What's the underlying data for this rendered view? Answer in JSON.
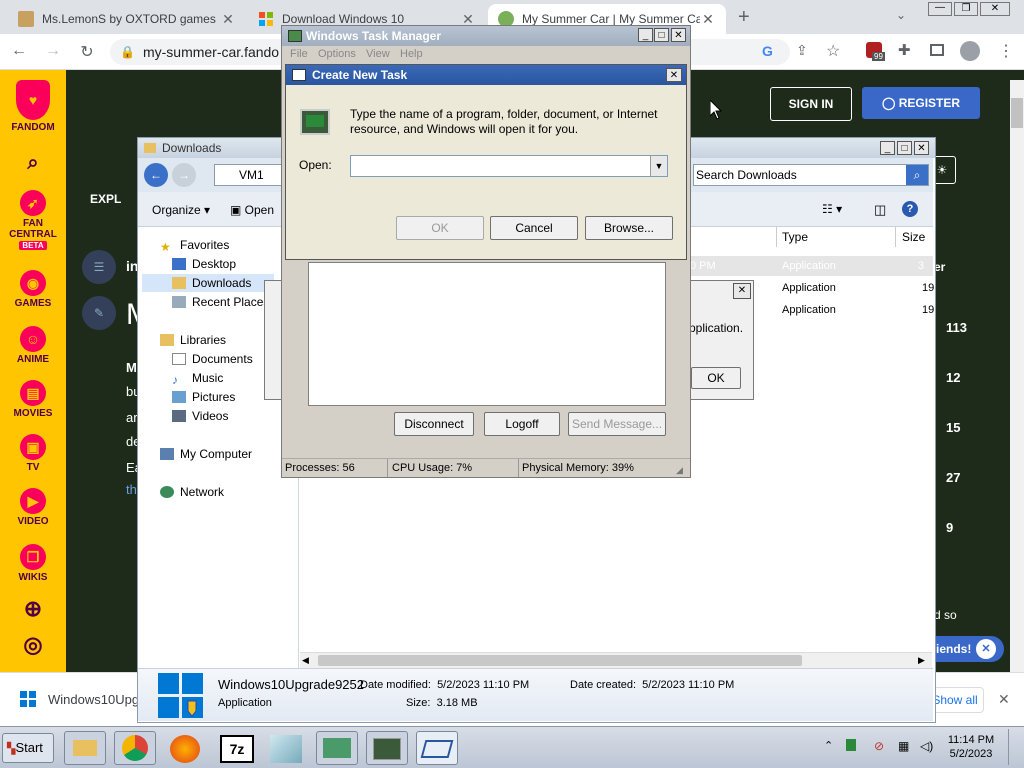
{
  "browser": {
    "tabs": [
      {
        "title": "Ms.LemonS by OXTORD games",
        "active": false
      },
      {
        "title": "Download Windows 10",
        "active": false
      },
      {
        "title": "My Summer Car | My Summer Car",
        "active": true
      }
    ],
    "new_tab": "+",
    "url": "my-summer-car.fando",
    "download_bar": {
      "file": "Windows10Upgra",
      "show_all": "Show all",
      "close": "✕"
    },
    "extension_badge": "99"
  },
  "fandom": {
    "logo": "FANDOM",
    "nav": [
      "FAN CENTRAL",
      "BETA",
      "GAMES",
      "ANIME",
      "MOVIES",
      "TV",
      "VIDEO",
      "WIKIS"
    ],
    "sign_in": "SIGN IN",
    "register": "REGISTER",
    "explore": "EXPL",
    "counts": [
      "113",
      "12",
      "15",
      "27",
      "9"
    ],
    "side_snips": [
      "er",
      "d so",
      "iends!"
    ],
    "page_letters": [
      "M",
      "in",
      "M",
      "bu",
      "ar",
      "de",
      "Ea",
      "th"
    ]
  },
  "explorer": {
    "title": "Downloads",
    "path": "VM1",
    "search_placeholder": "Search Downloads",
    "toolbar": {
      "organize": "Organize",
      "open": "Open"
    },
    "columns": {
      "type": "Type",
      "size": "Size"
    },
    "rows": [
      {
        "date_snip": "0 PM",
        "type": "Application",
        "size": "3"
      },
      {
        "type": "Application",
        "size": "19"
      },
      {
        "type": "Application",
        "size": "19"
      }
    ],
    "nav": {
      "favorites": "Favorites",
      "desktop": "Desktop",
      "downloads": "Downloads",
      "recent": "Recent Places",
      "libraries": "Libraries",
      "documents": "Documents",
      "music": "Music",
      "pictures": "Pictures",
      "videos": "Videos",
      "computer": "My Computer",
      "network": "Network"
    },
    "details": {
      "name": "Windows10Upgrade9252",
      "kind": "Application",
      "modified_label": "Date modified:",
      "modified": "5/2/2023 11:10 PM",
      "created_label": "Date created:",
      "created": "5/2/2023 11:10 PM",
      "size_label": "Size:",
      "size": "3.18 MB"
    }
  },
  "small_dialog": {
    "text": "pplication.",
    "ok": "OK",
    "close": "✕"
  },
  "task_manager": {
    "title": "Windows Task Manager",
    "menu": [
      "File",
      "Options",
      "View",
      "Help"
    ],
    "buttons": {
      "disconnect": "Disconnect",
      "logoff": "Logoff",
      "send": "Send Message..."
    },
    "status": {
      "processes": "Processes: 56",
      "cpu": "CPU Usage: 7%",
      "memory": "Physical Memory: 39%"
    }
  },
  "create_task": {
    "title": "Create New Task",
    "description": "Type the name of a program, folder, document, or Internet resource, and Windows will open it for you.",
    "open_label": "Open:",
    "open_value": "",
    "ok": "OK",
    "cancel": "Cancel",
    "browse": "Browse..."
  },
  "taskbar": {
    "start": "Start",
    "time": "11:14 PM",
    "date": "5/2/2023"
  }
}
